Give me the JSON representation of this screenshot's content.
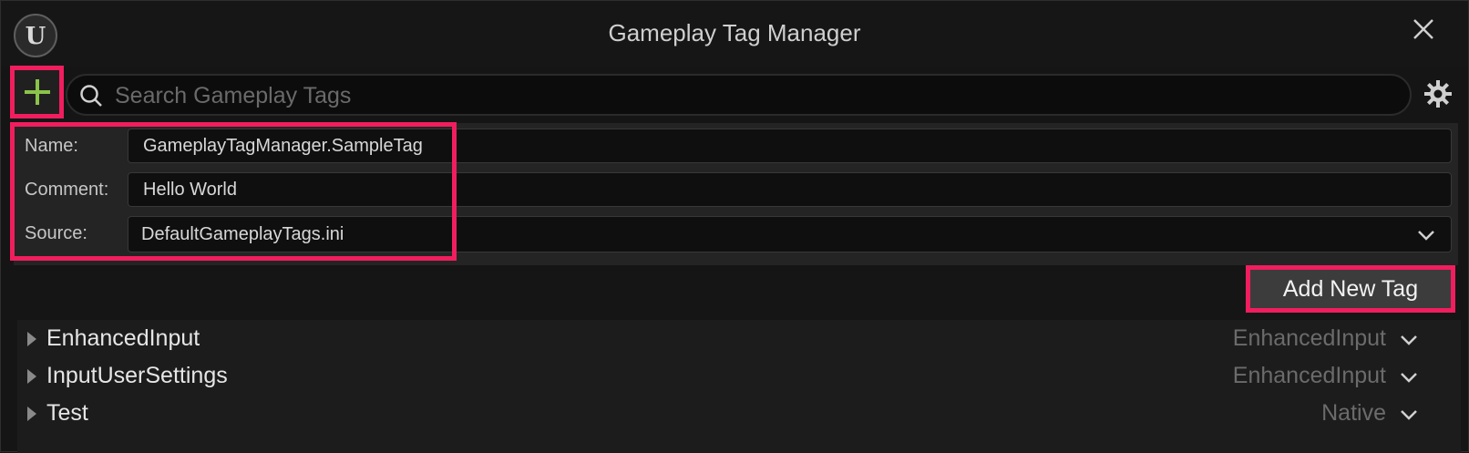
{
  "window": {
    "title": "Gameplay Tag Manager",
    "logo_glyph": "U"
  },
  "toolbar": {
    "search_placeholder": "Search Gameplay Tags",
    "search_value": ""
  },
  "form": {
    "name_label": "Name:",
    "name_value": "GameplayTagManager.SampleTag",
    "comment_label": "Comment:",
    "comment_value": "Hello World",
    "source_label": "Source:",
    "source_value": "DefaultGameplayTags.ini"
  },
  "actions": {
    "add_new_tag_label": "Add New Tag"
  },
  "tags": [
    {
      "name": "EnhancedInput",
      "source": "EnhancedInput"
    },
    {
      "name": "InputUserSettings",
      "source": "EnhancedInput"
    },
    {
      "name": "Test",
      "source": "Native"
    }
  ],
  "colors": {
    "highlight": "#f01e5e",
    "add_icon": "#8bc34a",
    "background": "#151515"
  }
}
